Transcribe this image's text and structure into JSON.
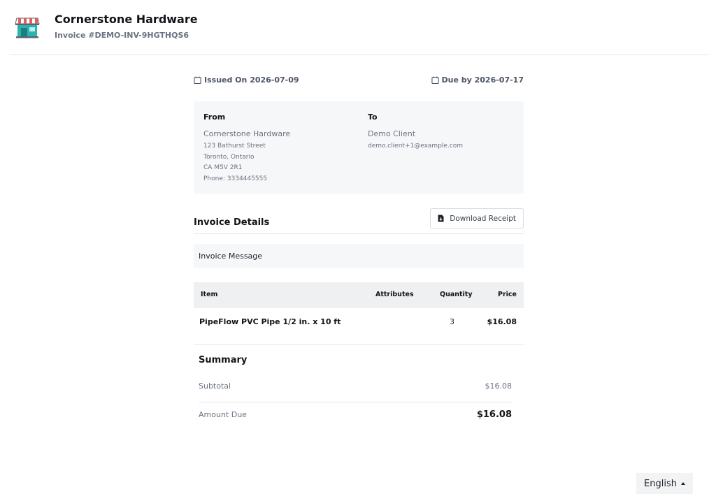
{
  "header": {
    "store_name": "Cornerstone Hardware",
    "invoice_number": "Invoice #DEMO-INV-9HGTHQS6",
    "store_icon": "storefront-icon"
  },
  "dates": {
    "issued": "Issued On 2026-07-09",
    "due": "Due by 2026-07-17",
    "icon": "calendar-icon"
  },
  "from": {
    "heading": "From",
    "name": "Cornerstone Hardware",
    "address_line1": "123 Bathurst Street",
    "address_line2": "Toronto, Ontario",
    "address_line3": "CA M5V 2R1",
    "phone": "Phone: 3334445555"
  },
  "to": {
    "heading": "To",
    "name": "Demo Client",
    "email": "demo.client+1@example.com"
  },
  "details": {
    "title": "Invoice Details",
    "download_label": "Download Receipt",
    "download_icon": "file-download-icon",
    "message": "Invoice Message"
  },
  "table": {
    "headers": {
      "item": "Item",
      "attributes": "Attributes",
      "quantity": "Quantity",
      "price": "Price"
    },
    "rows": [
      {
        "item": "PipeFlow PVC Pipe 1/2 in. x 10 ft",
        "attributes": "",
        "quantity": "3",
        "price": "$16.08"
      }
    ]
  },
  "summary": {
    "title": "Summary",
    "subtotal_label": "Subtotal",
    "subtotal_value": "$16.08",
    "amount_due_label": "Amount Due",
    "amount_due_value": "$16.08"
  },
  "language": {
    "selected": "English"
  },
  "colors": {
    "accent_teal": "#2bb3b1",
    "awning_red": "#e35d5b",
    "panel_bg": "#f6f7f9"
  }
}
